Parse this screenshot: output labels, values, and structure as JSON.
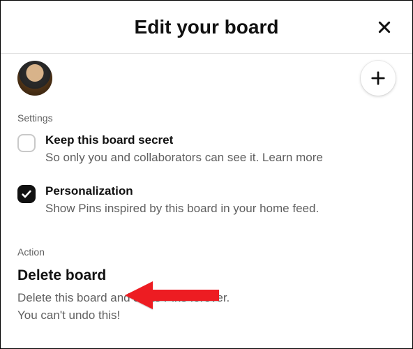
{
  "header": {
    "title": "Edit your board"
  },
  "settings": {
    "label": "Settings",
    "secret": {
      "title": "Keep this board secret",
      "desc": "So only you and collaborators can see it. ",
      "learn_more": "Learn more",
      "checked": false
    },
    "personalization": {
      "title": "Personalization",
      "desc": "Show Pins inspired by this board in your home feed.",
      "checked": true
    }
  },
  "action": {
    "label": "Action",
    "delete_title": "Delete board",
    "delete_desc_1": "Delete this board and all its Pins forever.",
    "delete_desc_2": "You can't undo this!"
  }
}
